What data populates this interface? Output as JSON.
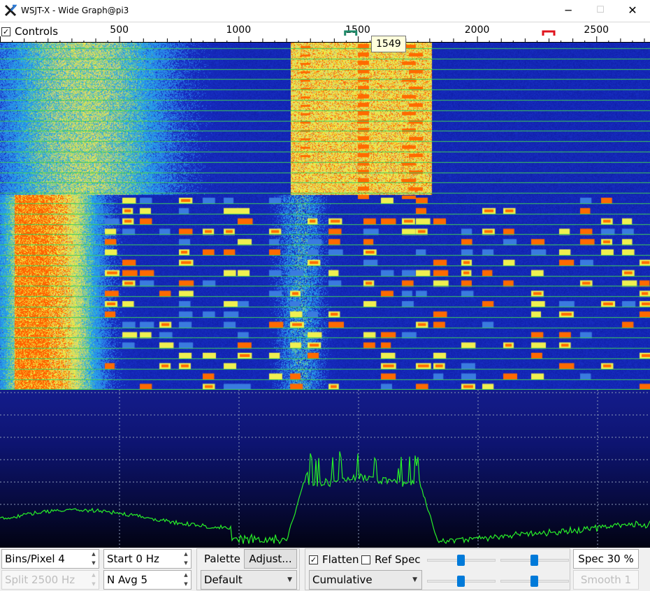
{
  "window": {
    "title": "WSJT-X - Wide Graph@pi3",
    "minimize": "─",
    "maximize": "☐",
    "close": "✕"
  },
  "ruler": {
    "controls_label": "Controls",
    "controls_checked": true,
    "ticks": [
      "500",
      "1000",
      "1500",
      "2000",
      "2500"
    ],
    "rx_marker_color": "#1f8a6a",
    "tx_marker_color": "#e0141e"
  },
  "tooltip": {
    "frequency": "1549"
  },
  "waterfall": {
    "colors": {
      "background": "#0b1a9c",
      "mid": "#3a7be0",
      "yellow": "#f0f050",
      "orange": "#ff6a00",
      "grid": "#3ccc5a"
    }
  },
  "spectrum": {
    "trace_color": "#28f028",
    "grid_style": "dotted"
  },
  "controls": {
    "bins_per_pixel": "Bins/Pixel  4",
    "split": "Split  2500  Hz",
    "start": "Start 0 Hz",
    "n_avg": "N Avg 5",
    "palette_label": "Palette",
    "adjust_label": "Adjust...",
    "palette_value": "Default",
    "flatten_label": "Flatten",
    "flatten_checked": true,
    "ref_spec_label": "Ref Spec",
    "ref_spec_checked": false,
    "spectrum_mode": "Cumulative",
    "spec_percent": "Spec 30 %",
    "smooth": "Smooth  1"
  }
}
